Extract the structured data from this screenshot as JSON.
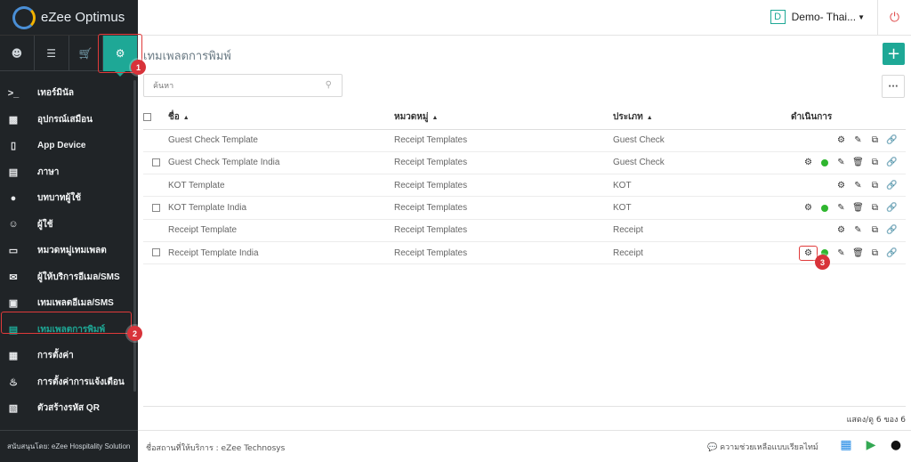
{
  "app": {
    "name": "eZee Optimus"
  },
  "header": {
    "property_initial": "D",
    "property_name": "Demo- Thai..."
  },
  "sidebar": {
    "tabs": [
      "user-icon",
      "list-icon",
      "cart-icon",
      "gear-icon"
    ],
    "items": [
      {
        "label": "เทอร์มินัล",
        "icon": "terminal-icon"
      },
      {
        "label": "อุปกรณ์เสมือน",
        "icon": "tablet-icon"
      },
      {
        "label": "App Device",
        "icon": "phone-icon"
      },
      {
        "label": "ภาษา",
        "icon": "language-icon"
      },
      {
        "label": "บทบาทผู้ใช้",
        "icon": "user-role-icon"
      },
      {
        "label": "ผู้ใช้",
        "icon": "user-icon"
      },
      {
        "label": "หมวดหมู่เทมเพลต",
        "icon": "inbox-icon"
      },
      {
        "label": "ผู้ให้บริการอีเมล/SMS",
        "icon": "mail-icon"
      },
      {
        "label": "เทมเพลตอีเมล/SMS",
        "icon": "template-icon"
      },
      {
        "label": "เทมเพลตการพิมพ์",
        "icon": "print-template-icon"
      },
      {
        "label": "การตั้งค่า",
        "icon": "settings-icon"
      },
      {
        "label": "การตั้งค่าการแจ้งเตือน",
        "icon": "bell-icon"
      },
      {
        "label": "ตัวสร้างรหัส QR",
        "icon": "qr-icon"
      }
    ],
    "footer": "สนับสนุนโดย: eZee Hospitality Solution"
  },
  "main": {
    "title": "เทมเพลตการพิมพ์",
    "search_placeholder": "ค้นหา",
    "columns": {
      "name": "ชื่อ",
      "category": "หมวดหมู่",
      "type": "ประเภท",
      "actions": "ดำเนินการ"
    },
    "rows": [
      {
        "name": "Guest Check Template",
        "category": "Receipt Templates",
        "type": "Guest Check",
        "custom": false
      },
      {
        "name": "Guest Check Template India",
        "category": "Receipt Templates",
        "type": "Guest Check",
        "custom": true
      },
      {
        "name": "KOT Template",
        "category": "Receipt Templates",
        "type": "KOT",
        "custom": false
      },
      {
        "name": "KOT Template India",
        "category": "Receipt Templates",
        "type": "KOT",
        "custom": true
      },
      {
        "name": "Receipt Template",
        "category": "Receipt Templates",
        "type": "Receipt",
        "custom": false
      },
      {
        "name": "Receipt Template India",
        "category": "Receipt Templates",
        "type": "Receipt",
        "custom": true
      }
    ],
    "page_info": "แสดง/ดู 6 ของ 6"
  },
  "footer": {
    "provider": "ชื่อสถานที่ให้บริการ : eZee Technosys",
    "help": "ความช่วยเหลือแบบเรียลไทม์"
  },
  "callouts": [
    "1",
    "2",
    "3"
  ],
  "colors": {
    "accent": "#1ea896",
    "sidebar": "#202427",
    "status": "#2fb62f",
    "callout": "#d8333a"
  }
}
